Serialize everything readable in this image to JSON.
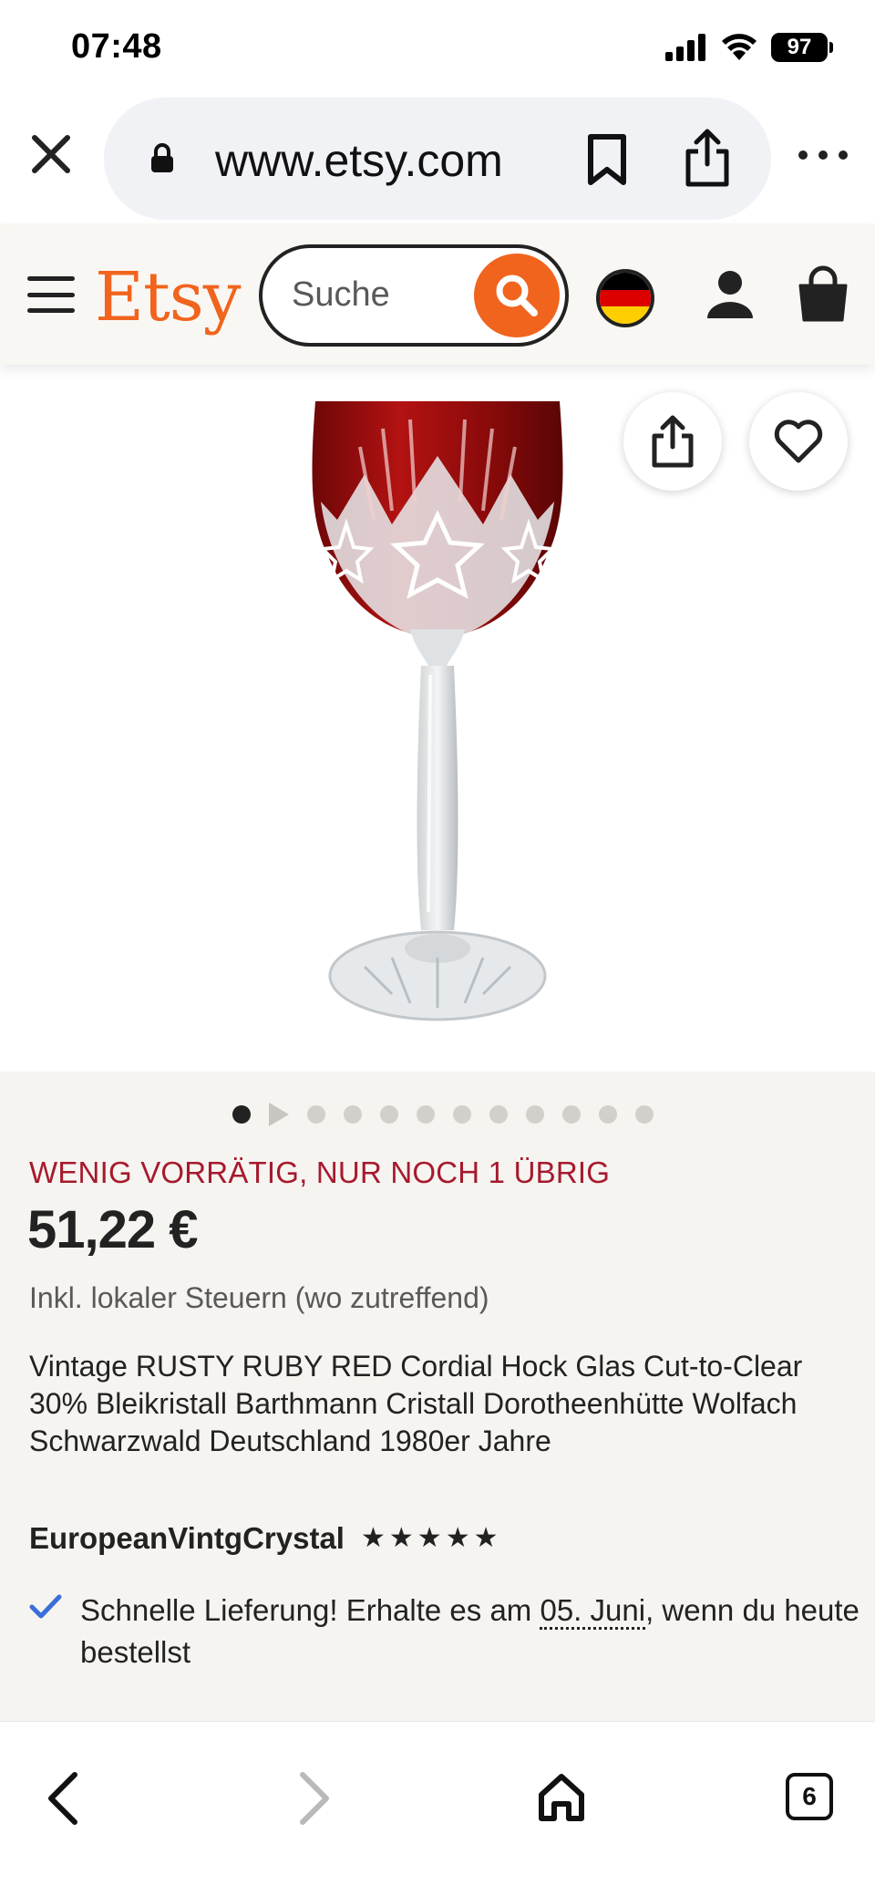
{
  "status_bar": {
    "time": "07:48",
    "battery": "97"
  },
  "browser": {
    "url": "www.etsy.com",
    "open_tabs": "6"
  },
  "header": {
    "logo": "Etsy",
    "search_placeholder": "Suche"
  },
  "gallery": {
    "image_count": 12,
    "active_index": 0
  },
  "product": {
    "stock_notice": "WENIG VORRÄTIG, NUR NOCH 1 ÜBRIG",
    "price": "51,22 €",
    "tax_note": "Inkl. lokaler Steuern (wo zutreffend)",
    "title": "Vintage RUSTY RUBY RED Cordial Hock Glas Cut-to-Clear 30% Bleikristall Barthmann Cristall Dorotheenhütte Wolfach Schwarzwald Deutschland 1980er Jahre",
    "shop_name": "EuropeanVintgCrystal",
    "rating": 5,
    "delivery_prefix": "Schnelle Lieferung! Erhalte es am ",
    "delivery_date": "05. Juni",
    "delivery_suffix": ", wenn du heute bestellst"
  },
  "colors": {
    "etsy_orange": "#f1641e",
    "stock_red": "#a61a2e",
    "header_bg": "#f9f7f3",
    "content_bg": "#f6f4f0",
    "check_blue": "#3a6fd8"
  }
}
